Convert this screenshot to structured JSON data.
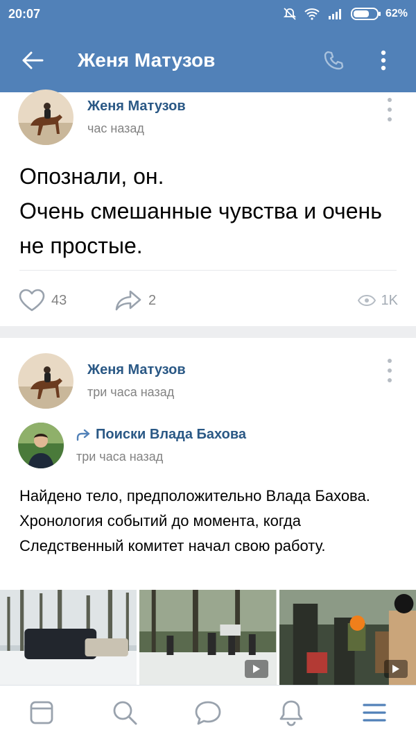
{
  "status_bar": {
    "time": "20:07",
    "battery_pct": "62%"
  },
  "header": {
    "title": "Женя Матузов",
    "icons": [
      "back-arrow-icon",
      "phone-icon",
      "more-vertical-icon"
    ]
  },
  "posts": [
    {
      "author": "Женя Матузов",
      "time": "час назад",
      "text": "Опознали, он.\nОчень смешанные чувства и очень не простые.",
      "likes": "43",
      "shares": "2",
      "views": "1K"
    },
    {
      "author": "Женя Матузов",
      "time": "три часа назад",
      "repost": {
        "source": "Поиски Влада Бахова",
        "time": "три часа назад"
      },
      "text": "Найдено тело, предположительно Влада Бахова. Хронология событий до момента, когда Следственный комитет начал свою работу."
    }
  ],
  "bottom_nav": [
    "news-icon",
    "search-icon",
    "messages-icon",
    "notifications-icon",
    "menu-icon"
  ],
  "colors": {
    "header_bg": "#5181b8",
    "link": "#2a5885",
    "muted": "#828282",
    "nav_active": "#5181b8",
    "nav_inactive": "#99a2ad"
  }
}
